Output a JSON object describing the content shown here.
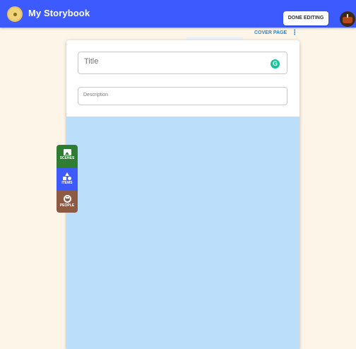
{
  "header": {
    "app_title": "My Storybook",
    "done_label": "DONE EDITING",
    "avatar_icon": "birthday-cake-avatar"
  },
  "page_menu": {
    "label": "COVER PAGE",
    "menu_icon": "kebab-menu-icon"
  },
  "editor": {
    "title_placeholder": "Title",
    "grammar_icon": "G",
    "description_placeholder": "Description"
  },
  "toolbox": {
    "items": [
      {
        "label": "SCENES",
        "icon": "image-icon",
        "color": "#2e7d32"
      },
      {
        "label": "ITEMS",
        "icon": "shapes-icon",
        "color": "#3d5afe"
      },
      {
        "label": "PEOPLE",
        "icon": "face-icon",
        "color": "#8d5a44"
      }
    ]
  },
  "colors": {
    "header_bg": "#3d5afe",
    "page_bg": "#fdf5e8",
    "canvas_bg": "#bbdefb"
  }
}
